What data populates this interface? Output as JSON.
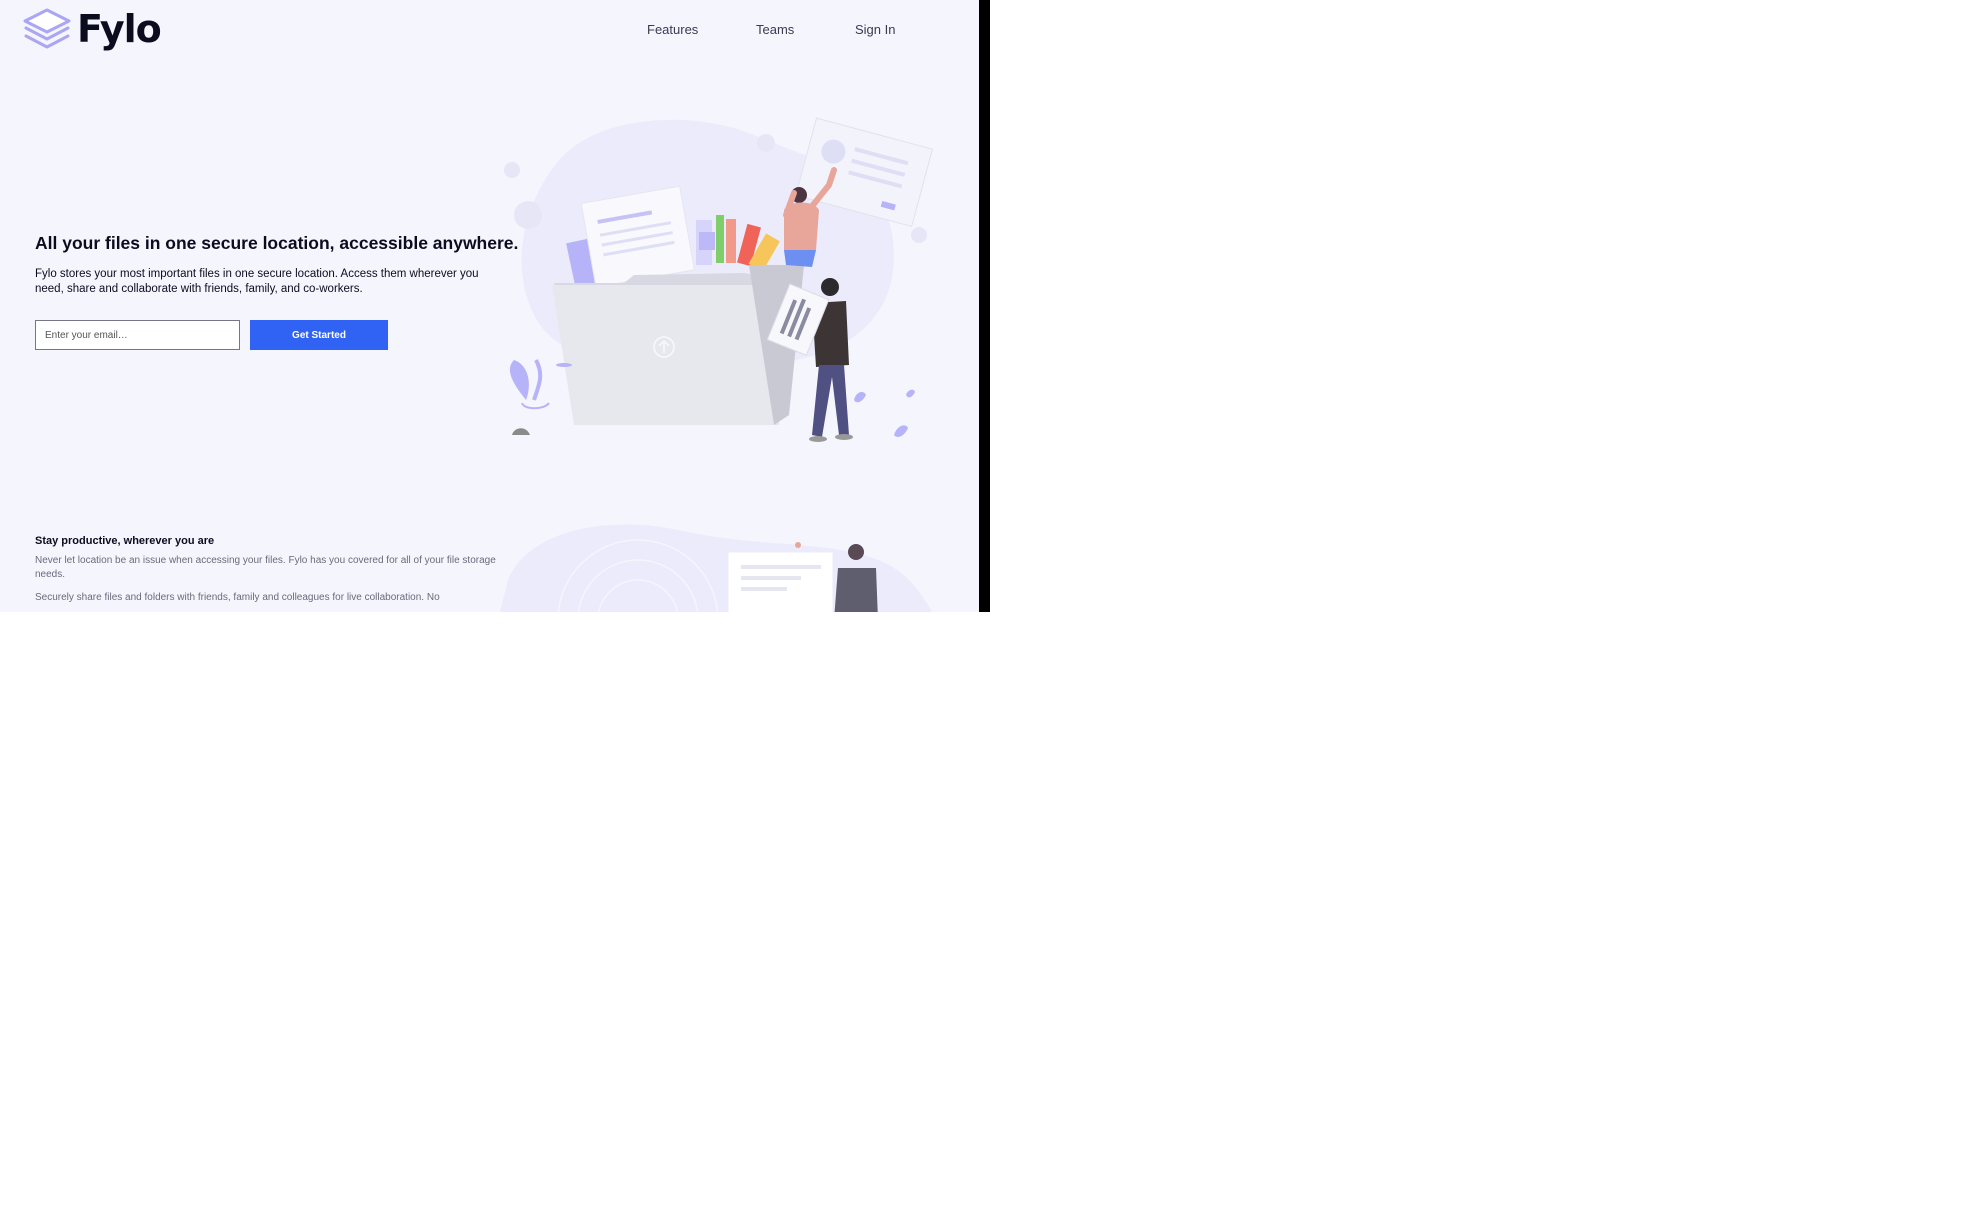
{
  "header": {
    "brand": "Fylo",
    "nav": [
      "Features",
      "Teams",
      "Sign In"
    ]
  },
  "hero": {
    "title": "All your files in one secure location, accessible anywhere.",
    "text": "Fylo stores your most important files in one secure location. Access them wherever you need, share and collaborate with friends, family, and co-workers.",
    "email_placeholder": "Enter your email…",
    "cta_label": "Get Started"
  },
  "productive": {
    "title": "Stay productive, wherever you are",
    "paragraphs": [
      "Never let location be an issue when accessing your files. Fylo has you covered for all of your file storage needs.",
      "Securely share files and folders with friends, family and colleagues for live collaboration. No"
    ]
  },
  "colors": {
    "background": "#f5f5fe",
    "accent": "#3063f4",
    "heading": "#0b0c1e",
    "illustration_purple": "#b6b3f8"
  },
  "icons": [
    "layers-logo-icon",
    "upload-arrow-icon"
  ]
}
